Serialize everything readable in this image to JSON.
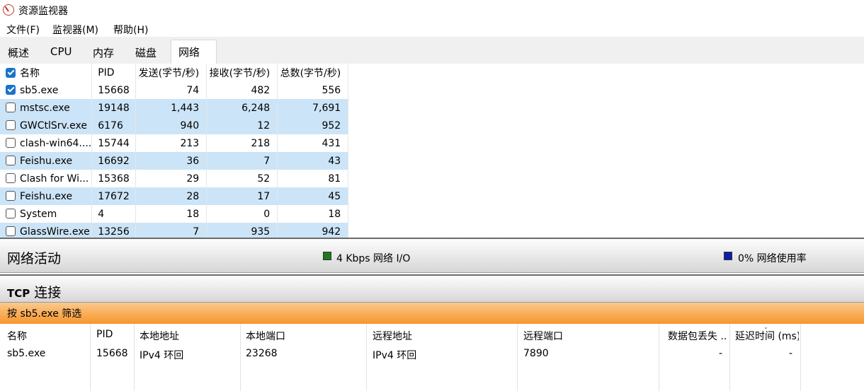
{
  "window": {
    "title": "资源监视器"
  },
  "menu": [
    "文件(F)",
    "监视器(M)",
    "帮助(H)"
  ],
  "tabs": [
    "概述",
    "CPU",
    "内存",
    "磁盘",
    "网络"
  ],
  "processes": {
    "columns": [
      "名称",
      "PID",
      "发送(字节/秒)",
      "接收(字节/秒)",
      "总数(字节/秒)"
    ],
    "rows": [
      {
        "name": "sb5.exe",
        "pid": "15668",
        "send": "74",
        "recv": "482",
        "total": "556",
        "checked": true,
        "highlight": false
      },
      {
        "name": "mstsc.exe",
        "pid": "19148",
        "send": "1,443",
        "recv": "6,248",
        "total": "7,691",
        "checked": false,
        "highlight": true
      },
      {
        "name": "GWCtlSrv.exe",
        "pid": "6176",
        "send": "940",
        "recv": "12",
        "total": "952",
        "checked": false,
        "highlight": true
      },
      {
        "name": "clash-win64....",
        "pid": "15744",
        "send": "213",
        "recv": "218",
        "total": "431",
        "checked": false,
        "highlight": false
      },
      {
        "name": "Feishu.exe",
        "pid": "16692",
        "send": "36",
        "recv": "7",
        "total": "43",
        "checked": false,
        "highlight": true
      },
      {
        "name": "Clash for Wi...",
        "pid": "15368",
        "send": "29",
        "recv": "52",
        "total": "81",
        "checked": false,
        "highlight": false
      },
      {
        "name": "Feishu.exe",
        "pid": "17672",
        "send": "28",
        "recv": "17",
        "total": "45",
        "checked": false,
        "highlight": true
      },
      {
        "name": "System",
        "pid": "4",
        "send": "18",
        "recv": "0",
        "total": "18",
        "checked": false,
        "highlight": false
      },
      {
        "name": "GlassWire.exe",
        "pid": "13256",
        "send": "7",
        "recv": "935",
        "total": "942",
        "checked": false,
        "highlight": true
      }
    ]
  },
  "network_activity": {
    "title": "网络活动",
    "io_label": "4 Kbps 网络 I/O",
    "io_color": "#1e7a1e",
    "usage_label": "0% 网络使用率",
    "usage_color": "#0a1fa8"
  },
  "tcp": {
    "title_bold": "TCP",
    "title_rest": " 连接",
    "filter": "按 sb5.exe 筛选",
    "columns": [
      "名称",
      "PID",
      "本地地址",
      "本地端口",
      "远程地址",
      "远程端口",
      "数据包丢失 ...",
      "延迟时间 (ms)"
    ],
    "rows": [
      [
        "sb5.exe",
        "15668",
        "IPv4 环回",
        "23268",
        "IPv4 环回",
        "7890",
        "-",
        "-"
      ]
    ]
  }
}
